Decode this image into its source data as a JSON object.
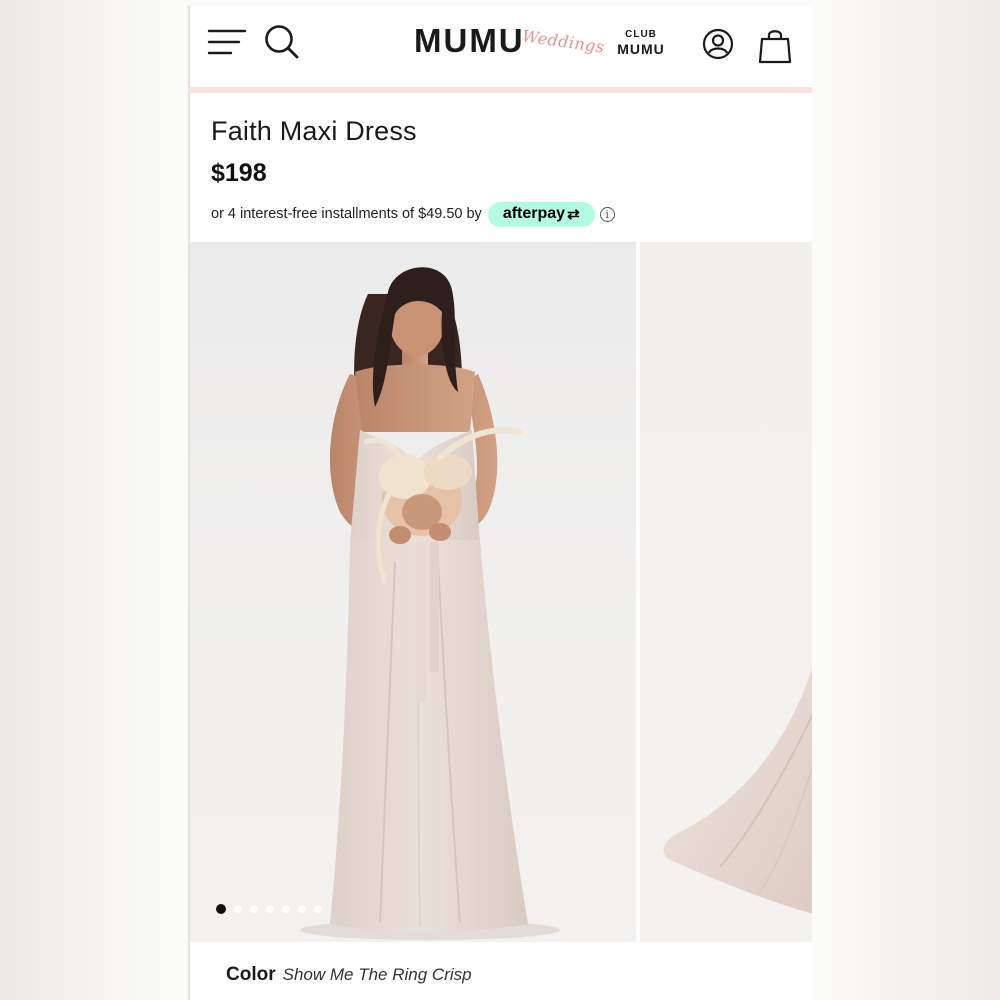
{
  "header": {
    "logo_main": "MUMU",
    "logo_script": "Weddings",
    "club_top": "CLUB",
    "club_bottom": "MUMU"
  },
  "product": {
    "title": "Faith Maxi Dress",
    "price": "$198",
    "installments_text": "or 4 interest-free installments of $49.50 by",
    "afterpay_label": "afterpay",
    "afterpay_arrows": "⇄",
    "info_glyph": "i"
  },
  "gallery": {
    "slide_count": 7,
    "active_index": 0
  },
  "color": {
    "label": "Color",
    "value": "Show Me The Ring Crisp"
  },
  "colors": {
    "accent_pink": "#fbe3dd",
    "logo_script": "#e98e92",
    "afterpay_mint": "#b2fce4",
    "dress": "#e8dcd5"
  },
  "icons": {
    "menu": "hamburger-menu-icon",
    "search": "search-icon",
    "account": "account-icon",
    "bag": "shopping-bag-icon",
    "info": "info-icon"
  }
}
